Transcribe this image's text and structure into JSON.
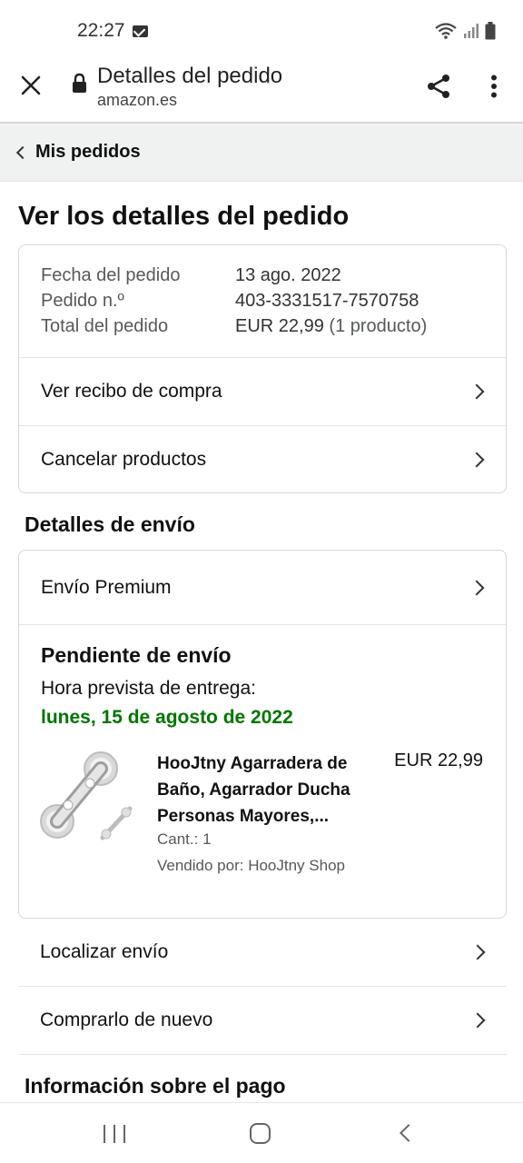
{
  "status_bar": {
    "time": "22:27"
  },
  "browser": {
    "title": "Detalles del pedido",
    "url": "amazon.es"
  },
  "breadcrumb": {
    "label": "Mis pedidos"
  },
  "page_title": "Ver los detalles del pedido",
  "order_summary": {
    "rows": [
      {
        "label": "Fecha del pedido",
        "value": "13 ago. 2022"
      },
      {
        "label": "Pedido n.º",
        "value": "403-3331517-7570758"
      },
      {
        "label": "Total del pedido",
        "value": "EUR 22,99",
        "extra": "(1 producto)"
      }
    ],
    "links": [
      {
        "label": "Ver recibo de compra"
      },
      {
        "label": "Cancelar productos"
      }
    ]
  },
  "shipping": {
    "section_title": "Detalles de envío",
    "method": "Envío Premium",
    "status": "Pendiente de envío",
    "delivery_label": "Hora prevista de entrega:",
    "delivery_date": "lunes, 15 de agosto de 2022",
    "product": {
      "title_line1": "HooJtny Agarradera de",
      "title_line2": "Baño, Agarrador Ducha",
      "title_line3": "Personas Mayores,...",
      "price": "EUR 22,99",
      "quantity": "Cant.: 1",
      "seller": "Vendido por: HooJtny Shop"
    }
  },
  "actions": [
    {
      "label": "Localizar envío"
    },
    {
      "label": "Comprarlo de nuevo"
    }
  ],
  "payment": {
    "section_title": "Información sobre el pago"
  },
  "colors": {
    "delivery_green": "#007600",
    "breadcrumb_bg": "#f0f2f2"
  }
}
